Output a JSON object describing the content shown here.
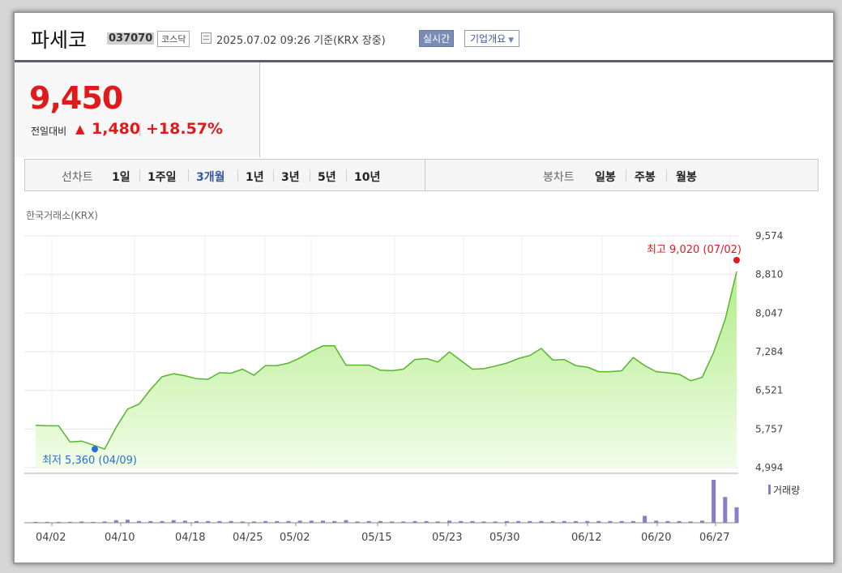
{
  "header": {
    "name": "파세코",
    "code": "037070",
    "market": "코스닥",
    "datetime": "2025.07.02 09:26  기준(KRX 장중)",
    "realtime_label": "실시간",
    "company_label": "기업개요"
  },
  "quote": {
    "price": "9,450",
    "change_label": "전일대비",
    "change_arrow": "▲",
    "change_value": "1,480",
    "separator": "|",
    "change_pct": "+18.57%"
  },
  "tabs": {
    "line_label": "선차트",
    "line_periods": [
      "1일",
      "1주일",
      "3개월",
      "1년",
      "3년",
      "5년",
      "10년"
    ],
    "active_period": "3개월",
    "candle_label": "봉차트",
    "candle_periods": [
      "일봉",
      "주봉",
      "월봉"
    ]
  },
  "source": "한국거래소(KRX)",
  "chart_data": {
    "type": "area",
    "yticks": [
      "9,574",
      "8,810",
      "8,047",
      "7,284",
      "6,521",
      "5,757",
      "4,994"
    ],
    "ylim": [
      4994,
      9574
    ],
    "xticks": [
      "04/02",
      "04/10",
      "04/18",
      "04/25",
      "05/02",
      "05/15",
      "05/23",
      "05/30",
      "06/12",
      "06/20",
      "06/27"
    ],
    "max_label": "최고 9,020 (07/02)",
    "min_label": "최저 5,360 (04/09)",
    "legend": "거래량",
    "colors": {
      "line": "#55b52c",
      "fill_top": "#b2ec8a",
      "fill_bottom": "#f1fde7",
      "volume": "#8b7dc6",
      "max": "#e01a1a",
      "min": "#2a6dd9"
    },
    "price_series": [
      5830,
      5820,
      5820,
      5500,
      5520,
      5440,
      5360,
      5790,
      6150,
      6250,
      6540,
      6790,
      6850,
      6810,
      6750,
      6740,
      6870,
      6860,
      6940,
      6820,
      7010,
      7010,
      7060,
      7160,
      7290,
      7400,
      7400,
      7020,
      7020,
      7020,
      6920,
      6910,
      6940,
      7130,
      7150,
      7080,
      7280,
      7110,
      6940,
      6950,
      7000,
      7060,
      7150,
      7210,
      7350,
      7120,
      7130,
      7010,
      6980,
      6890,
      6890,
      6910,
      7170,
      7010,
      6890,
      6870,
      6840,
      6710,
      6780,
      7270,
      7920,
      8870
    ],
    "volume_series": [
      0.02,
      0.02,
      0.02,
      0.02,
      0.03,
      0.02,
      0.03,
      0.06,
      0.07,
      0.04,
      0.04,
      0.04,
      0.06,
      0.05,
      0.04,
      0.04,
      0.04,
      0.04,
      0.03,
      0.03,
      0.04,
      0.04,
      0.04,
      0.05,
      0.05,
      0.05,
      0.04,
      0.06,
      0.03,
      0.04,
      0.04,
      0.03,
      0.03,
      0.04,
      0.04,
      0.03,
      0.05,
      0.04,
      0.04,
      0.03,
      0.03,
      0.04,
      0.04,
      0.04,
      0.04,
      0.04,
      0.04,
      0.04,
      0.04,
      0.04,
      0.04,
      0.04,
      0.04,
      0.16,
      0.05,
      0.04,
      0.04,
      0.03,
      0.05,
      1.0,
      0.6,
      0.36
    ]
  }
}
